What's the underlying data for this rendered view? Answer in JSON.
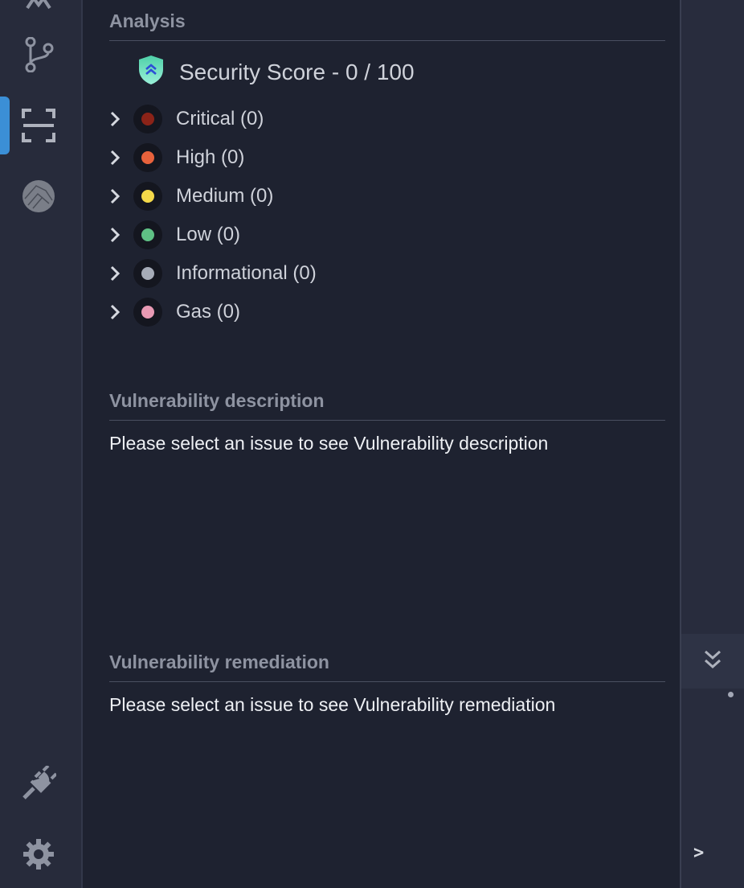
{
  "activity_bar": {
    "items": [
      {
        "name": "extensions-icon"
      },
      {
        "name": "source-control-icon"
      },
      {
        "name": "scan-icon"
      },
      {
        "name": "avatar"
      },
      {
        "name": "plug-icon"
      },
      {
        "name": "gear-icon"
      }
    ]
  },
  "analysis": {
    "title": "Analysis",
    "score_label": "Security Score - 0 / 100",
    "severities": [
      {
        "label": "Critical (0)",
        "color": "#8b2318"
      },
      {
        "label": "High (0)",
        "color": "#e8623c"
      },
      {
        "label": "Medium (0)",
        "color": "#f4d94a"
      },
      {
        "label": "Low (0)",
        "color": "#5fc185"
      },
      {
        "label": "Informational (0)",
        "color": "#a6acb8"
      },
      {
        "label": "Gas (0)",
        "color": "#e89ab4"
      }
    ]
  },
  "description": {
    "title": "Vulnerability description",
    "text": "Please select an issue to see Vulnerability description"
  },
  "remediation": {
    "title": "Vulnerability remediation",
    "text": "Please select an issue to see Vulnerability remediation"
  },
  "right_strip": {
    "prompt": ">"
  },
  "colors": {
    "accent": "#3b8fd6",
    "background": "#1e2230"
  }
}
